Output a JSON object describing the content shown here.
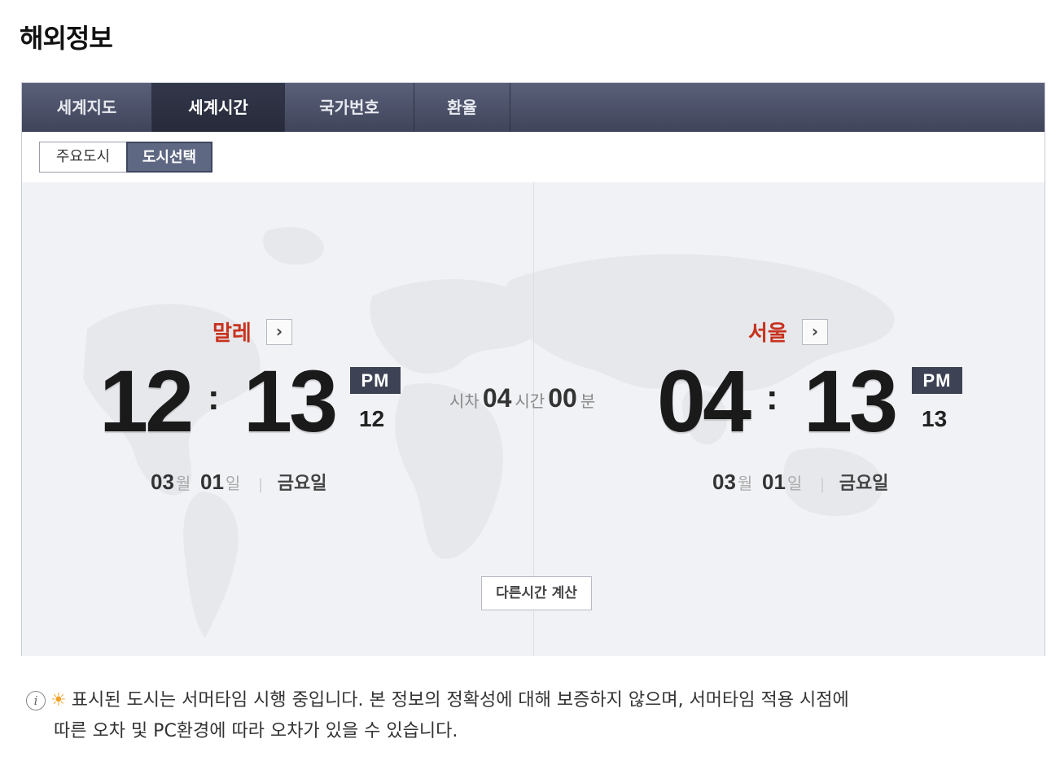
{
  "page": {
    "title": "해외정보"
  },
  "tabs": [
    {
      "label": "세계지도",
      "active": false
    },
    {
      "label": "세계시간",
      "active": true
    },
    {
      "label": "국가번호",
      "active": false
    },
    {
      "label": "환율",
      "active": false
    }
  ],
  "subtabs": {
    "main_cities": "주요도시",
    "city_select": "도시선택",
    "selected": "도시선택"
  },
  "left_city": {
    "name": "말레",
    "arrow_icon": "chevron-right-icon",
    "hour": "12",
    "minute": "13",
    "colon": ":",
    "ampm": "PM",
    "second": "12",
    "month": "03",
    "month_unit": "월",
    "day": "01",
    "day_unit": "일",
    "weekday": "금요일"
  },
  "right_city": {
    "name": "서울",
    "arrow_icon": "chevron-right-icon",
    "hour": "04",
    "minute": "13",
    "colon": ":",
    "ampm": "PM",
    "second": "13",
    "month": "03",
    "month_unit": "월",
    "day": "01",
    "day_unit": "일",
    "weekday": "금요일"
  },
  "time_diff": {
    "label": "시차",
    "hours": "04",
    "hours_unit": "시간",
    "minutes": "00",
    "minutes_unit": "분"
  },
  "calc_button": "다른시간 계산",
  "notice": {
    "line1": "표시된 도시는 서머타임 시행 중입니다. 본 정보의 정확성에 대해 보증하지 않으며, 서머타임 적용 시점에",
    "line2": "따른 오차 및 PC환경에 따라 오차가 있을 수 있습니다.",
    "icons": [
      "info-icon",
      "sun-icon"
    ]
  },
  "colors": {
    "tab_bg": "#4a4f66",
    "accent_red": "#c8321e",
    "ampm_bg": "#3d4255",
    "map_bg": "#f1f2f5"
  }
}
